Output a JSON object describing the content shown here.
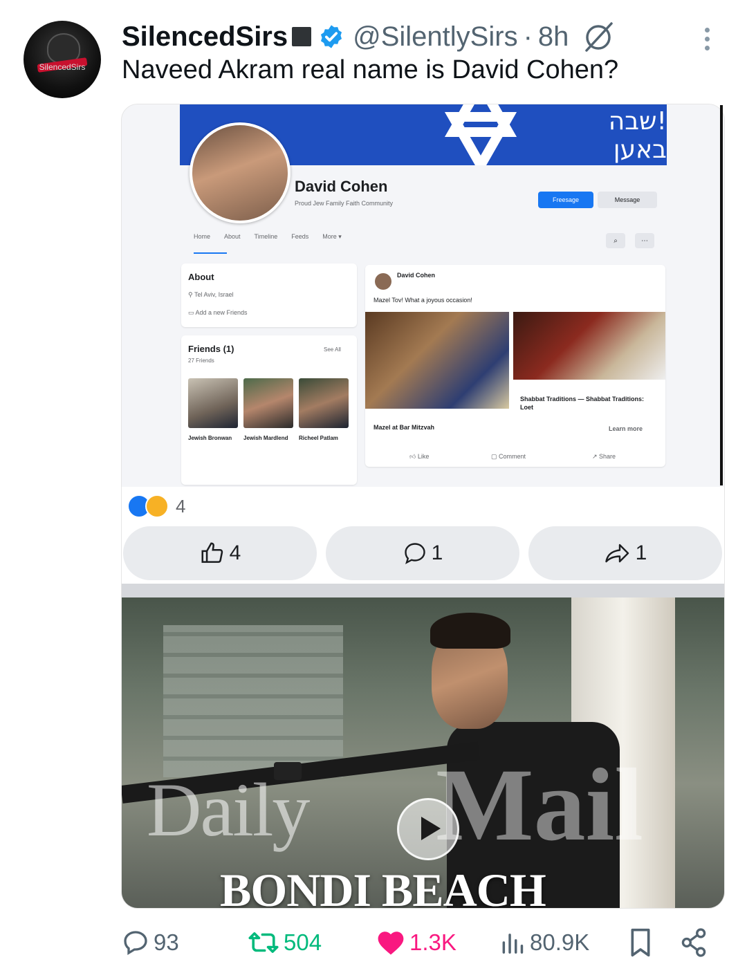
{
  "author": {
    "display_name": "SilencedSirs",
    "handle": "@SilentlySirs",
    "separator": "·",
    "time": "8h",
    "avatar_text": "SilencedSirs"
  },
  "tweet": {
    "text": "Naveed Akram real name is David Cohen?"
  },
  "fb_screenshot": {
    "banner_text": "!שבה באען",
    "profile_name": "David Cohen",
    "profile_sub": "Proud Jew Family Faith Community",
    "btn_primary": "Freesage",
    "btn_secondary": "Message",
    "tabs": [
      "Home",
      "About",
      "Timeline",
      "Feeds",
      "More ▾"
    ],
    "about": {
      "title": "About",
      "location": "Tel Aviv, Israel",
      "add": "Add a new Friends"
    },
    "friends": {
      "title": "Friends (1)",
      "count": "27 Friends",
      "see_all": "See All",
      "people": [
        {
          "name": "Jewish Bronwan"
        },
        {
          "name": "Jewish Mardlend"
        },
        {
          "name": "Richeel Patlam"
        }
      ]
    },
    "post": {
      "author": "David Cohen",
      "text": "Mazel Tov! What a joyous occasion!",
      "caption1": "Mazel at Bar Mitzvah",
      "link_title": "Shabbat Traditions — Shabbat Traditions: Loet",
      "learn_more": "Learn more",
      "like": "Like",
      "comment": "Comment",
      "share": "Share"
    },
    "reaction_count": "4",
    "like_count": "4",
    "comment_count": "1",
    "share_count": "1"
  },
  "video": {
    "watermark_daily": "Daily",
    "watermark_mail": "Mail",
    "caption": "BONDI BEACH"
  },
  "actions": {
    "replies": "93",
    "reposts": "504",
    "likes": "1.3K",
    "views": "80.9K"
  },
  "colors": {
    "verified": "#1d9bf0",
    "repost": "#00ba7c",
    "like": "#f91880",
    "muted": "#536471",
    "fb_blue": "#1877f2"
  }
}
